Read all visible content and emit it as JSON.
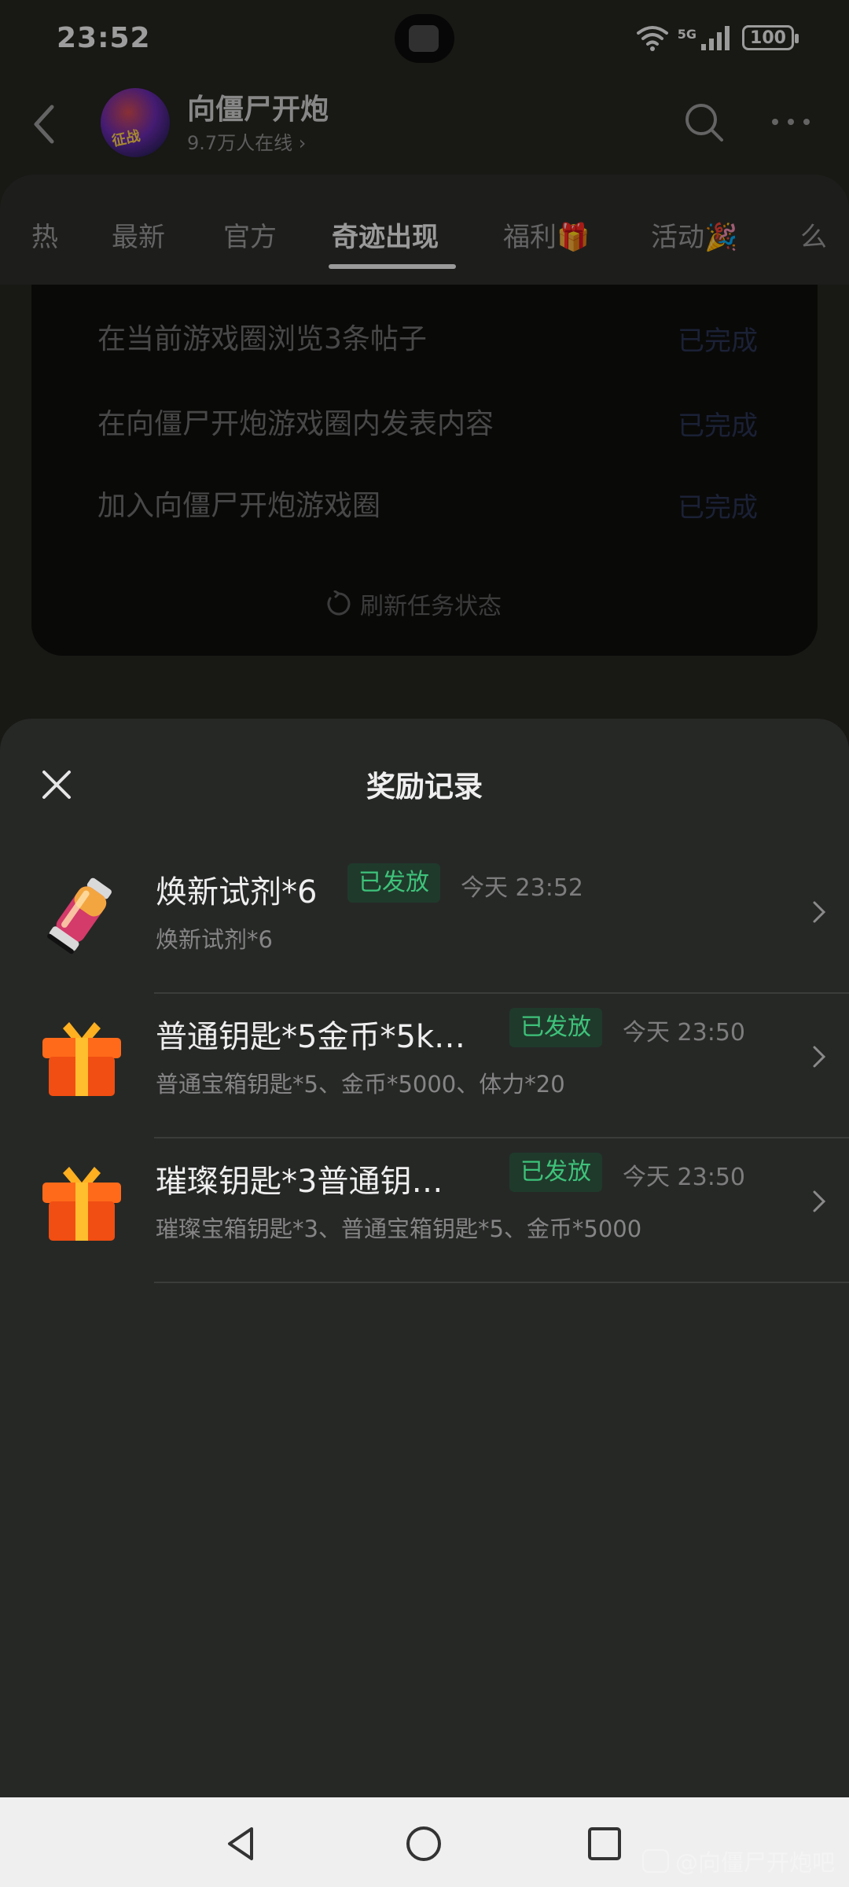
{
  "status_bar": {
    "time": "23:52",
    "network": "5G",
    "battery": "100"
  },
  "header": {
    "circle_name": "向僵尸开炮",
    "online": "9.7万人在线 ›",
    "avatar_text": "征战"
  },
  "tabs": [
    {
      "label": "热"
    },
    {
      "label": "最新"
    },
    {
      "label": "官方"
    },
    {
      "label": "奇迹出现"
    },
    {
      "label": "福利🎁"
    },
    {
      "label": "活动🎉"
    },
    {
      "label": "么"
    }
  ],
  "tasks": [
    {
      "name": "在当前游戏圈浏览3条帖子",
      "status": "已完成"
    },
    {
      "name": "在向僵尸开炮游戏圈内发表内容",
      "status": "已完成"
    },
    {
      "name": "加入向僵尸开炮游戏圈",
      "status": "已完成"
    }
  ],
  "refresh_label": "刷新任务状态",
  "sheet": {
    "title": "奖励记录",
    "rewards": [
      {
        "title": "焕新试剂*6",
        "badge": "已发放",
        "time": "今天 23:52",
        "desc": "焕新试剂*6",
        "icon": "potion-icon"
      },
      {
        "title": "普通钥匙*5金币*5k…",
        "badge": "已发放",
        "time": "今天 23:50",
        "desc": "普通宝箱钥匙*5、金币*5000、体力*20",
        "icon": "gift-box-icon"
      },
      {
        "title": "璀璨钥匙*3普通钥…",
        "badge": "已发放",
        "time": "今天 23:50",
        "desc": "璀璨宝箱钥匙*3、普通宝箱钥匙*5、金币*5000",
        "icon": "gift-box-icon"
      }
    ]
  },
  "watermark": "@向僵尸开炮吧",
  "colors": {
    "badge_text": "#3ec27a",
    "badge_bg": "#1f3a2b",
    "task_status": "#2a3454"
  }
}
